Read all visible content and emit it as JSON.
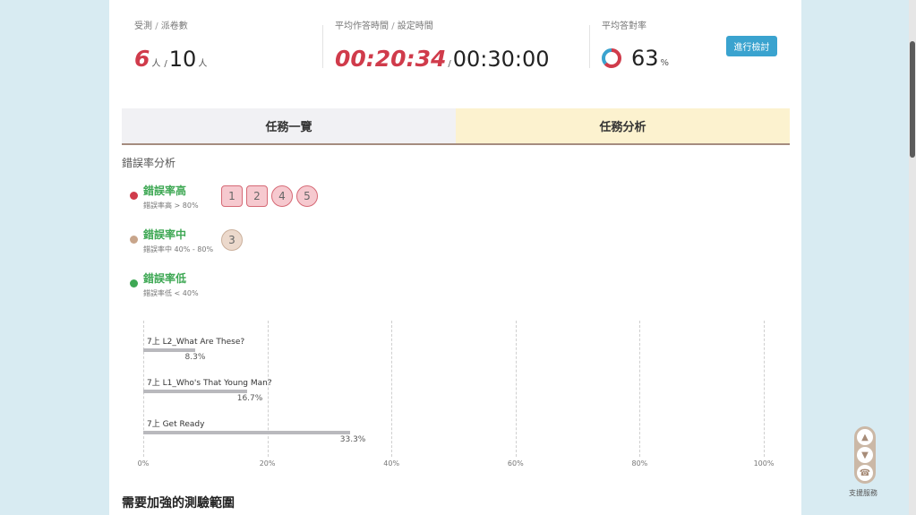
{
  "stats": {
    "attendance": {
      "label_a": "受測",
      "sep": "/",
      "label_b": "派卷數",
      "tested": "6",
      "unit": "人",
      "slash": "/",
      "assigned": "10"
    },
    "time": {
      "label_a": "平均作答時間",
      "sep": "/",
      "label_b": "設定時間",
      "avg": "00:20:34",
      "slash": "/",
      "set": "00:30:00"
    },
    "accuracy": {
      "label": "平均答對率",
      "value": "63",
      "unit": "%",
      "fraction": 0.63
    },
    "check_button": "進行檢討"
  },
  "colors": {
    "red": "#d03b4b",
    "blue": "#3aa3cf",
    "green": "#3ea854",
    "brown": "#c8a58b",
    "accent": "#3aa3cf"
  },
  "tabs": [
    {
      "label": "任務一覽",
      "active": false
    },
    {
      "label": "任務分析",
      "active": true
    }
  ],
  "error_section": {
    "title": "錯誤率分析",
    "levels": [
      {
        "name": "錯誤率高",
        "desc": "錯誤率高 > 80%",
        "color": "#d03b4b",
        "questions": [
          "1",
          "2",
          "4",
          "5"
        ]
      },
      {
        "name": "錯誤率中",
        "desc": "錯誤率中 40% - 80%",
        "color": "#c8a58b",
        "questions": [
          "3"
        ]
      },
      {
        "name": "錯誤率低",
        "desc": "錯誤率低 < 40%",
        "color": "#3ea854",
        "questions": []
      }
    ]
  },
  "chart_data": {
    "type": "bar",
    "orientation": "horizontal",
    "categories": [
      "7上 L2_What Are These?",
      "7上 L1_Who's That Young Man?",
      "7上 Get Ready"
    ],
    "values": [
      8.3,
      16.7,
      33.3
    ],
    "value_labels": [
      "8.3%",
      "16.7%",
      "33.3%"
    ],
    "xlim": [
      0,
      100
    ],
    "x_ticks": [
      "0%",
      "20%",
      "40%",
      "60%",
      "80%",
      "100%"
    ],
    "grid": true
  },
  "bottom_section": {
    "title": "需要加強的測驗範圍"
  },
  "support": {
    "label": "支援服務"
  },
  "icons": {
    "up": "arrow-up-icon",
    "down": "arrow-down-icon",
    "support": "headset-icon"
  }
}
